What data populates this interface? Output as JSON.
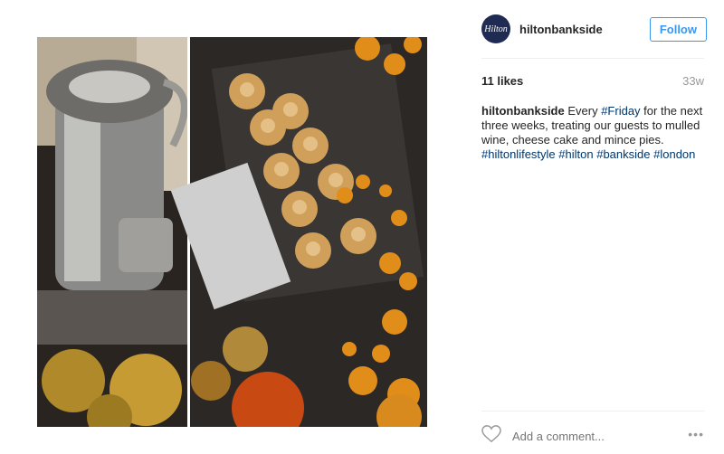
{
  "post": {
    "image_alt": "Christmas treats photo collage",
    "username": "hiltonbankside",
    "avatar_text": "Hilton",
    "follow_label": "Follow",
    "likes": "11 likes",
    "age": "33w",
    "caption": {
      "user": "hiltonbankside",
      "part1": " Every ",
      "tag_friday": "#Friday",
      "part2": " for the next three weeks, treating our guests to mulled wine, cheese cake and mince pies. ",
      "tag1": "#hiltonlifestyle",
      "tag2": "#hilton",
      "tag3": "#bankside",
      "tag4": "#london"
    },
    "comment_placeholder": "Add a comment...",
    "more_label": "•••"
  },
  "icons": [
    "heart-icon",
    "more-options-icon"
  ],
  "colors": {
    "accent": "#3897f0",
    "hashtag": "#003569",
    "muted": "#999999"
  }
}
